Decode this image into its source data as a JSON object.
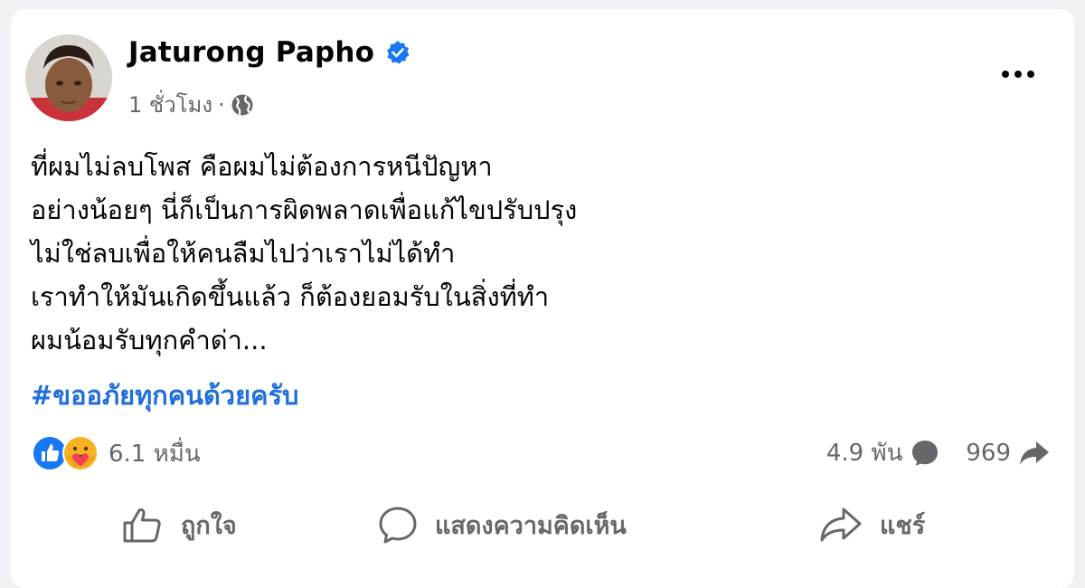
{
  "post": {
    "author": "Jaturong Papho",
    "time": "1 ชั่วโมง",
    "separator": "·",
    "body_lines": [
      "ที่ผมไม่ลบโพส คือผมไม่ต้องการหนีปัญหา",
      "อย่างน้อยๆ นี่ก็เป็นการผิดพลาดเพื่อแก้ไขปรับปรุง",
      "ไม่ใช่ลบเพื่อให้คนลืมไปว่าเราไม่ได้ทำ",
      "เราทำให้มันเกิดขึ้นแล้ว ก็ต้องยอมรับในสิ่งที่ทำ",
      "ผมน้อมรับทุกคำด่า..."
    ],
    "hashtag": "#ขออภัยทุกคนด้วยครับ"
  },
  "engagement": {
    "reactions_count": "6.1 หมื่น",
    "comments_count": "4.9 พัน",
    "shares_count": "969"
  },
  "actions": {
    "like_label": "ถูกใจ",
    "comment_label": "แสดงความคิดเห็น",
    "share_label": "แชร์"
  },
  "icons": {
    "verified": "verified-badge-icon",
    "audience": "globe-icon",
    "more": "more-options-icon",
    "reaction_1": "like-reaction-icon",
    "reaction_2": "care-reaction-icon",
    "comment_stat": "comment-bubble-icon",
    "share_stat": "share-arrow-icon"
  },
  "colors": {
    "link_blue": "#216fdb",
    "verified_blue": "#1877f2",
    "secondary_text": "#65676b",
    "care_yellow": "#f7b125",
    "care_red": "#f33e58"
  }
}
